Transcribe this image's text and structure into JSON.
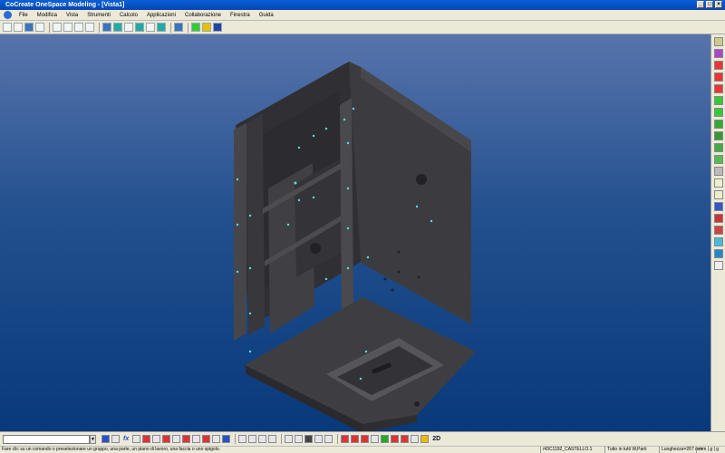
{
  "window": {
    "title": "CoCreate OneSpace Modeling - [Vista1]"
  },
  "menu": [
    "File",
    "Modifica",
    "Vista",
    "Strumenti",
    "Calcolo",
    "Applicazioni",
    "Collaborazione",
    "Finestra",
    "Guida"
  ],
  "bottom_toolbar": {
    "mode_label": "2D",
    "fx_label": "fx"
  },
  "status": {
    "message": "Fare clic su un comando o preselezionare un gruppo, una parte, un piano di lavoro, una faccia o uno spigolo.",
    "part": "/43C1192_CASTELLO.1",
    "filter": "Tutto in tutti W,Parti",
    "length": "Lunghezza=267 mm",
    "units": "mm | g | g"
  },
  "colors": {
    "title_bar": "#0546b0",
    "viewport_top": "#5774ab",
    "viewport_bottom": "#08397a",
    "model": "#3a3a3e",
    "highlight": "#4ee0e8"
  }
}
